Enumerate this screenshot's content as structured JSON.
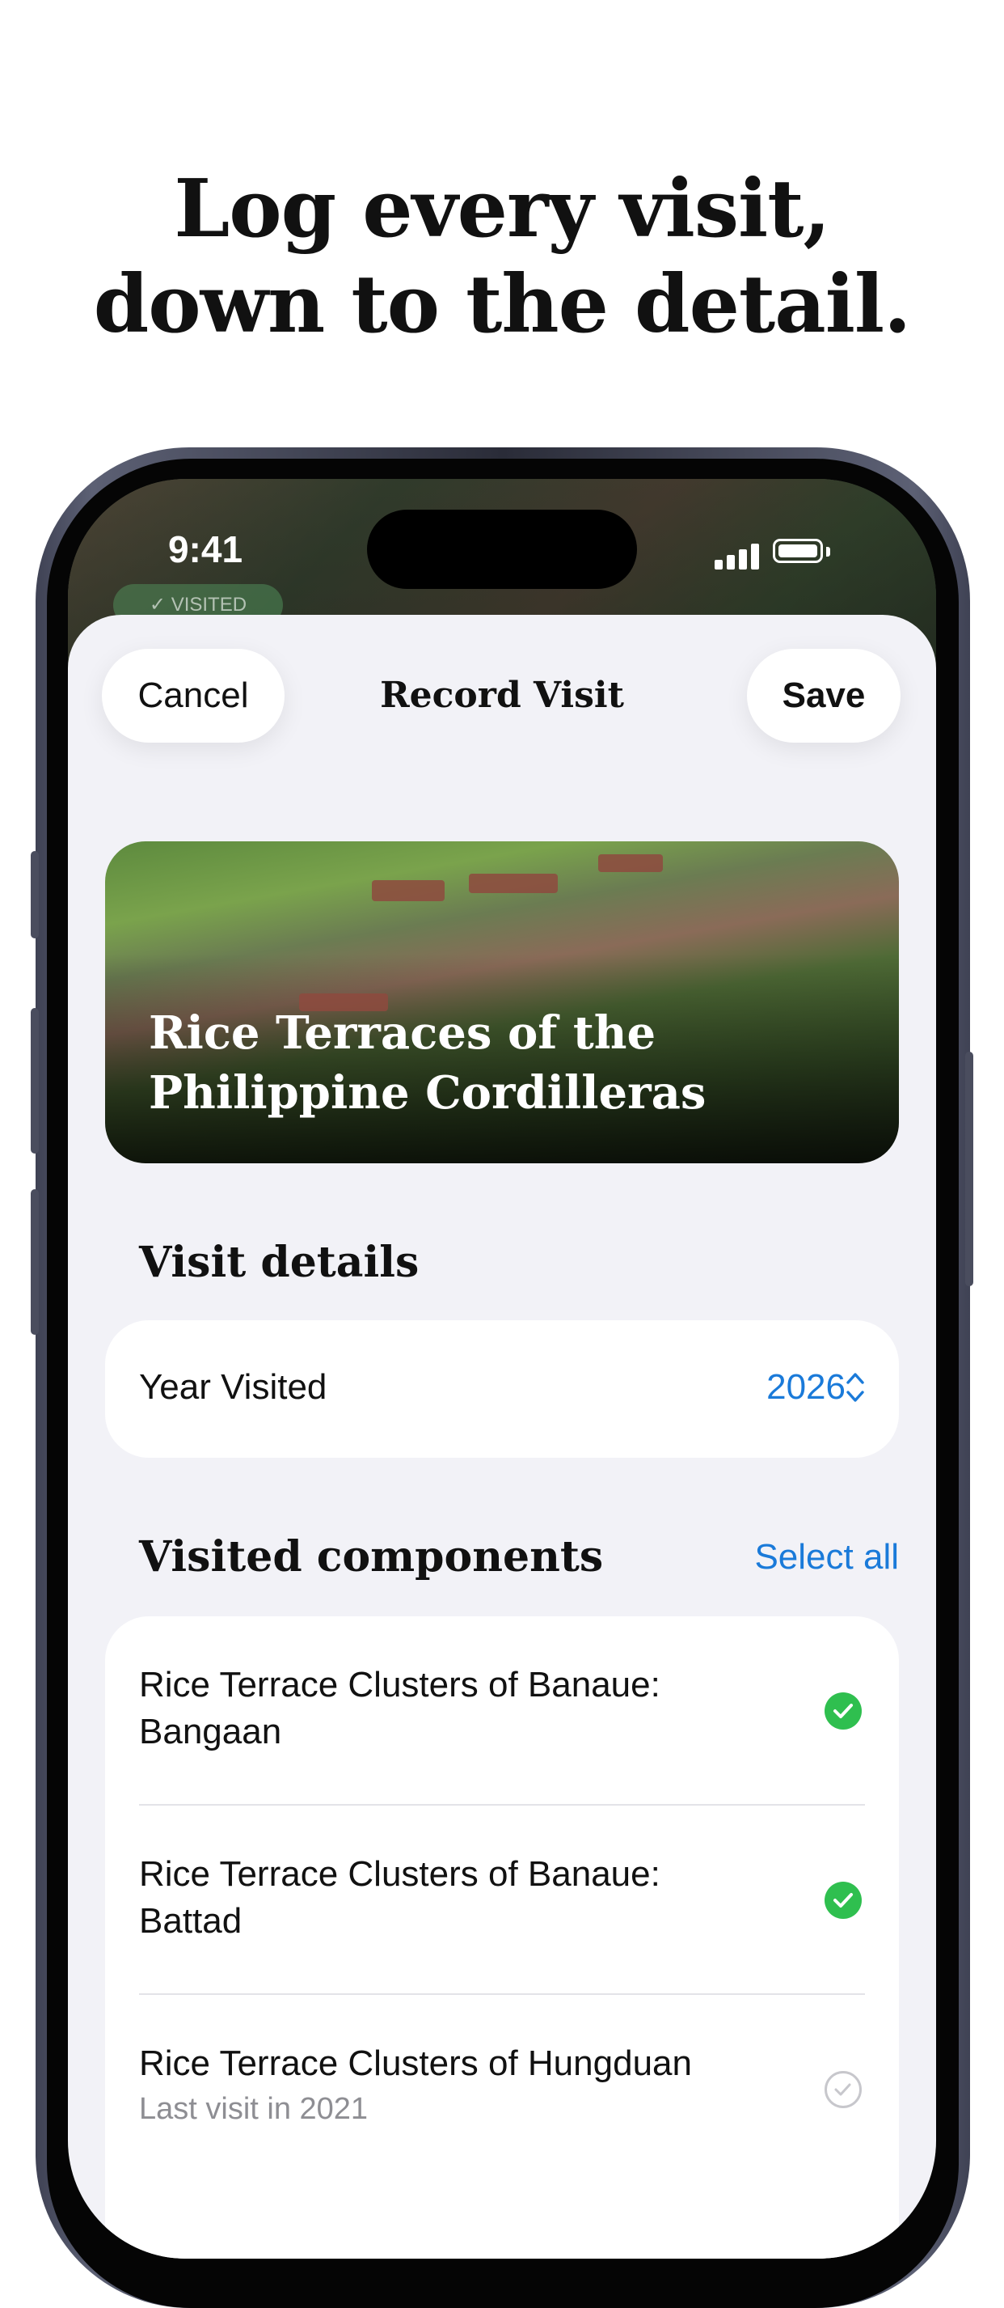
{
  "headline": {
    "line1": "Log every visit,",
    "line2": "down to the detail."
  },
  "status_bar": {
    "time": "9:41"
  },
  "background": {
    "badge": "✓ VISITED"
  },
  "sheet": {
    "cancel_label": "Cancel",
    "title": "Record Visit",
    "save_label": "Save",
    "hero_title": "Rice Terraces of the Philippine Cordilleras"
  },
  "visit_details": {
    "heading": "Visit details",
    "year_label": "Year Visited",
    "year_value": "2026"
  },
  "components": {
    "heading": "Visited components",
    "select_all": "Select all",
    "items": [
      {
        "name": "Rice Terrace Clusters of Banaue: Bangaan",
        "sub": "",
        "checked": true
      },
      {
        "name": "Rice Terrace Clusters of Banaue: Battad",
        "sub": "",
        "checked": true
      },
      {
        "name": "Rice Terrace Clusters of Hungduan",
        "sub": "Last visit in 2021",
        "checked": false
      }
    ]
  },
  "colors": {
    "accent": "#1a7ad9",
    "check_green": "#2fbf4f",
    "sheet_bg": "#f2f2f7"
  }
}
